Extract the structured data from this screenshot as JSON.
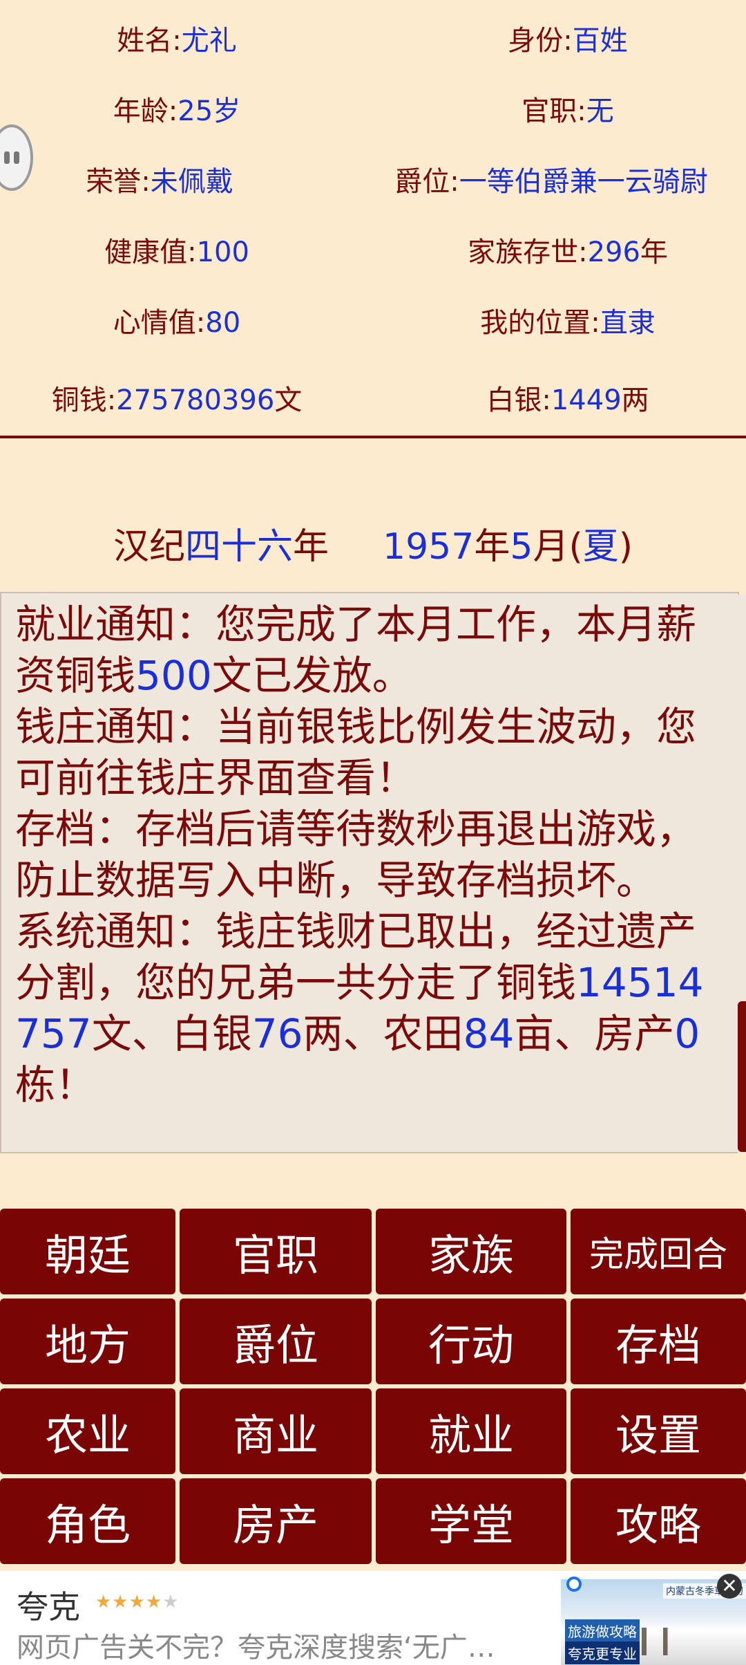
{
  "stats": {
    "name_label": "姓名:",
    "name": "尤礼",
    "identity_label": "身份:",
    "identity": "百姓",
    "age_label": "年龄:",
    "age": "25岁",
    "office_label": "官职:",
    "office": "无",
    "honor_label": "荣誉:",
    "honor": "未佩戴",
    "title_label": "爵位:",
    "title": "一等伯爵兼一云骑尉",
    "health_label": "健康值:",
    "health": "100",
    "family_label": "家族存世:",
    "family_years": "296",
    "family_unit": "年",
    "mood_label": "心情值:",
    "mood": "80",
    "location_label": "我的位置:",
    "location": "直隶",
    "copper_label": "铜钱:",
    "copper": "275780396",
    "copper_unit": "文",
    "silver_label": "白银:",
    "silver": "1449",
    "silver_unit": "两"
  },
  "date": {
    "era_prefix": "汉纪",
    "era_num": "四十六",
    "era_suffix": "年",
    "year": "1957",
    "year_suffix": "年",
    "month": "5",
    "month_suffix": "月(",
    "season": "夏",
    "close": ")"
  },
  "messages": {
    "m1_a": "就业通知：您完成了本月工作，本月薪资铜钱",
    "m1_amount": "500",
    "m1_b": "文已发放。",
    "m2": "钱庄通知：当前银钱比例发生波动，您可前往钱庄界面查看！",
    "m3": "存档：存档后请等待数秒再退出游戏，防止数据写入中断，导致存档损坏。",
    "m4_a": "系统通知：钱庄钱财已取出，经过遗产分割，您的兄弟一共分走了铜钱",
    "m4_copper": "14514757",
    "m4_b": "文、白银",
    "m4_silver": "76",
    "m4_c": "两、农田",
    "m4_land": "84",
    "m4_d": "亩、房产",
    "m4_house": "0",
    "m4_e": "栋！"
  },
  "buttons": {
    "court": "朝廷",
    "office": "官职",
    "family": "家族",
    "end_turn": "完成回合",
    "local": "地方",
    "peerage": "爵位",
    "action": "行动",
    "save": "存档",
    "agriculture": "农业",
    "commerce": "商业",
    "employment": "就业",
    "settings": "设置",
    "character": "角色",
    "property": "房产",
    "school": "学堂",
    "guide": "攻略"
  },
  "ad": {
    "title": "夸克",
    "rating_stars": 4,
    "description": "网页广告关不完？夸克深度搜索‘无广…",
    "image_tag1": "内蒙古冬季草原初",
    "image_tag2": "旅游做攻略",
    "image_tag3": "夸克更专业",
    "close": "✕"
  },
  "colors": {
    "background": "#fdebd0",
    "primary": "#7a0a0a",
    "value": "#1b2fd6",
    "button": "#7a0505"
  }
}
